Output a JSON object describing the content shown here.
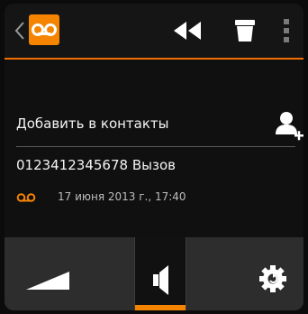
{
  "colors": {
    "accent": "#f58400",
    "background": "#101010",
    "bottom_bar": "#2d2d2d"
  },
  "toolbar": {
    "back_icon": "chevron-left-icon",
    "app_icon": "voicemail-icon",
    "actions": [
      {
        "icon": "rewind-icon"
      },
      {
        "icon": "trash-icon"
      },
      {
        "icon": "overflow-menu-icon"
      }
    ]
  },
  "message": {
    "add_to_contacts": "Добавить в контакты",
    "add_contact_icon": "add-contact-icon",
    "caller": "0123412345678 Вызов",
    "meta_icon": "voicemail-icon",
    "datetime": "17 июня 2013 г., 17:40"
  },
  "controls": [
    {
      "icon": "volume-icon"
    },
    {
      "icon": "speaker-icon",
      "selected": true
    },
    {
      "icon": "settings-icon"
    }
  ]
}
